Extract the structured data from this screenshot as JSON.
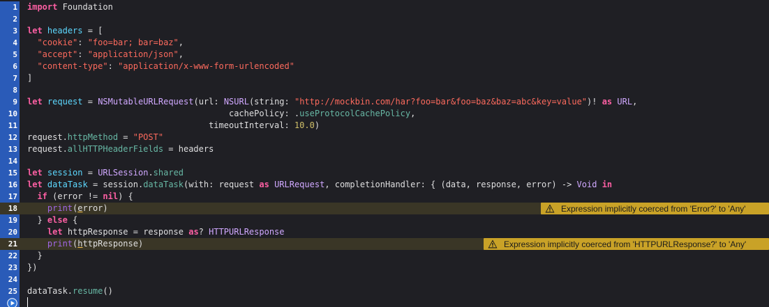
{
  "editor": {
    "lines": [
      {
        "n": "1"
      },
      {
        "n": "2"
      },
      {
        "n": "3"
      },
      {
        "n": "4"
      },
      {
        "n": "5"
      },
      {
        "n": "6"
      },
      {
        "n": "7"
      },
      {
        "n": "8"
      },
      {
        "n": "9"
      },
      {
        "n": "10"
      },
      {
        "n": "11"
      },
      {
        "n": "12"
      },
      {
        "n": "13"
      },
      {
        "n": "14"
      },
      {
        "n": "15"
      },
      {
        "n": "16"
      },
      {
        "n": "17"
      },
      {
        "n": "18"
      },
      {
        "n": "19"
      },
      {
        "n": "20"
      },
      {
        "n": "21"
      },
      {
        "n": "22"
      },
      {
        "n": "23"
      },
      {
        "n": "24"
      },
      {
        "n": "25"
      }
    ],
    "code": [
      [
        [
          "kw",
          "import"
        ],
        [
          "pl",
          " Foundation"
        ]
      ],
      [],
      [
        [
          "kw",
          "let"
        ],
        [
          "pl",
          " "
        ],
        [
          "decl",
          "headers"
        ],
        [
          "pl",
          " = ["
        ]
      ],
      [
        [
          "pl",
          "  "
        ],
        [
          "str",
          "\"cookie\""
        ],
        [
          "pl",
          ": "
        ],
        [
          "str",
          "\"foo=bar; bar=baz\""
        ],
        [
          "pl",
          ","
        ]
      ],
      [
        [
          "pl",
          "  "
        ],
        [
          "str",
          "\"accept\""
        ],
        [
          "pl",
          ": "
        ],
        [
          "str",
          "\"application/json\""
        ],
        [
          "pl",
          ","
        ]
      ],
      [
        [
          "pl",
          "  "
        ],
        [
          "str",
          "\"content-type\""
        ],
        [
          "pl",
          ": "
        ],
        [
          "str",
          "\"application/x-www-form-urlencoded\""
        ]
      ],
      [
        [
          "pl",
          "]"
        ]
      ],
      [],
      [
        [
          "kw",
          "let"
        ],
        [
          "pl",
          " "
        ],
        [
          "decl",
          "request"
        ],
        [
          "pl",
          " = "
        ],
        [
          "ty",
          "NSMutableURLRequest"
        ],
        [
          "pl",
          "(url: "
        ],
        [
          "ty",
          "NSURL"
        ],
        [
          "pl",
          "(string: "
        ],
        [
          "str",
          "\"http://mockbin.com/har?foo=bar&foo=baz&baz=abc&key=value\""
        ],
        [
          "pl",
          ")! "
        ],
        [
          "kw",
          "as"
        ],
        [
          "pl",
          " "
        ],
        [
          "ty",
          "URL"
        ],
        [
          "pl",
          ","
        ]
      ],
      [
        [
          "pl",
          "                                        cachePolicy: ."
        ],
        [
          "prop",
          "useProtocolCachePolicy"
        ],
        [
          "pl",
          ","
        ]
      ],
      [
        [
          "pl",
          "                                    timeoutInterval: "
        ],
        [
          "num",
          "10.0"
        ],
        [
          "pl",
          ")"
        ]
      ],
      [
        [
          "pl",
          "request."
        ],
        [
          "prop",
          "httpMethod"
        ],
        [
          "pl",
          " = "
        ],
        [
          "str",
          "\"POST\""
        ]
      ],
      [
        [
          "pl",
          "request."
        ],
        [
          "prop",
          "allHTTPHeaderFields"
        ],
        [
          "pl",
          " = headers"
        ]
      ],
      [],
      [
        [
          "kw",
          "let"
        ],
        [
          "pl",
          " "
        ],
        [
          "decl",
          "session"
        ],
        [
          "pl",
          " = "
        ],
        [
          "ty",
          "URLSession"
        ],
        [
          "pl",
          "."
        ],
        [
          "prop",
          "shared"
        ]
      ],
      [
        [
          "kw",
          "let"
        ],
        [
          "pl",
          " "
        ],
        [
          "decl",
          "dataTask"
        ],
        [
          "pl",
          " = session."
        ],
        [
          "prop",
          "dataTask"
        ],
        [
          "pl",
          "(with: request "
        ],
        [
          "kw",
          "as"
        ],
        [
          "pl",
          " "
        ],
        [
          "ty",
          "URLRequest"
        ],
        [
          "pl",
          ", completionHandler: { (data, response, error) -> "
        ],
        [
          "ty",
          "Void"
        ],
        [
          "pl",
          " "
        ],
        [
          "kw",
          "in"
        ]
      ],
      [
        [
          "pl",
          "  "
        ],
        [
          "kw",
          "if"
        ],
        [
          "pl",
          " (error != "
        ],
        [
          "kw",
          "nil"
        ],
        [
          "pl",
          ") {"
        ]
      ],
      [
        [
          "pl",
          "    "
        ],
        [
          "fn",
          "print"
        ],
        [
          "pl",
          "("
        ],
        [
          "uline",
          "e"
        ],
        [
          "pl",
          "rror)"
        ]
      ],
      [
        [
          "pl",
          "  } "
        ],
        [
          "kw",
          "else"
        ],
        [
          "pl",
          " {"
        ]
      ],
      [
        [
          "pl",
          "    "
        ],
        [
          "kw",
          "let"
        ],
        [
          "pl",
          " httpResponse = response "
        ],
        [
          "kw",
          "as"
        ],
        [
          "pl",
          "? "
        ],
        [
          "ty",
          "HTTPURLResponse"
        ]
      ],
      [
        [
          "pl",
          "    "
        ],
        [
          "fn",
          "print"
        ],
        [
          "pl",
          "("
        ],
        [
          "uline",
          "h"
        ],
        [
          "pl",
          "ttpResponse)"
        ]
      ],
      [
        [
          "pl",
          "  }"
        ]
      ],
      [
        [
          "pl",
          "})"
        ]
      ],
      [],
      [
        [
          "pl",
          "dataTask."
        ],
        [
          "prop",
          "resume"
        ],
        [
          "pl",
          "()"
        ]
      ]
    ],
    "warnings": [
      {
        "line": 18,
        "text": "Expression implicitly coerced from 'Error?' to 'Any'",
        "icon": "warning-triangle-icon"
      },
      {
        "line": 21,
        "text": "Expression implicitly coerced from 'HTTPURLResponse?' to 'Any'",
        "icon": "warning-triangle-icon"
      }
    ]
  },
  "colors": {
    "background": "#1f1f24",
    "gutter_accent": "#2a5bb8",
    "keyword": "#fc5fa3",
    "string": "#fc6a5d",
    "number": "#d0bf69",
    "type": "#d0a8ff",
    "property": "#67b7a4",
    "declaration": "#5dd8ff",
    "warning_banner": "#c9a227"
  }
}
